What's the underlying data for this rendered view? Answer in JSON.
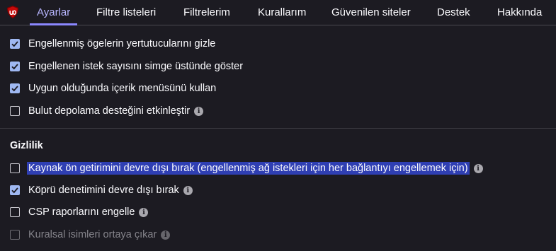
{
  "tabs": [
    {
      "label": "Ayarlar",
      "active": true
    },
    {
      "label": "Filtre listeleri",
      "active": false
    },
    {
      "label": "Filtrelerim",
      "active": false
    },
    {
      "label": "Kurallarım",
      "active": false
    },
    {
      "label": "Güvenilen siteler",
      "active": false
    },
    {
      "label": "Destek",
      "active": false
    },
    {
      "label": "Hakkında",
      "active": false
    }
  ],
  "logo_icon": "ublock-origin-shield-icon",
  "colors": {
    "background": "#1c1b22",
    "accent": "#8b88ff",
    "checkbox_checked": "#9fb8f2",
    "highlight": "#2f3fb3"
  },
  "appearance": {
    "options": [
      {
        "label": "Engellenmiş ögelerin yertutucularını gizle",
        "checked": true,
        "info": false
      },
      {
        "label": "Engellenen istek sayısını simge üstünde göster",
        "checked": true,
        "info": false
      },
      {
        "label": "Uygun olduğunda içerik menüsünü kullan",
        "checked": true,
        "info": false
      },
      {
        "label": "Bulut depolama desteğini etkinleştir",
        "checked": false,
        "info": true
      }
    ]
  },
  "privacy": {
    "title": "Gizlilik",
    "options": [
      {
        "label": "Kaynak ön getirimini devre dışı bırak (engellenmiş ağ istekleri için her bağlantıyı engellemek için)",
        "checked": false,
        "info": true,
        "selected_text": true
      },
      {
        "label": "Köprü denetimini devre dışı bırak",
        "checked": true,
        "info": true
      },
      {
        "label": "CSP raporlarını engelle",
        "checked": false,
        "info": true
      },
      {
        "label": "Kuralsal isimleri ortaya çıkar",
        "checked": false,
        "info": true,
        "disabled": true
      }
    ]
  },
  "info_glyph": "i"
}
